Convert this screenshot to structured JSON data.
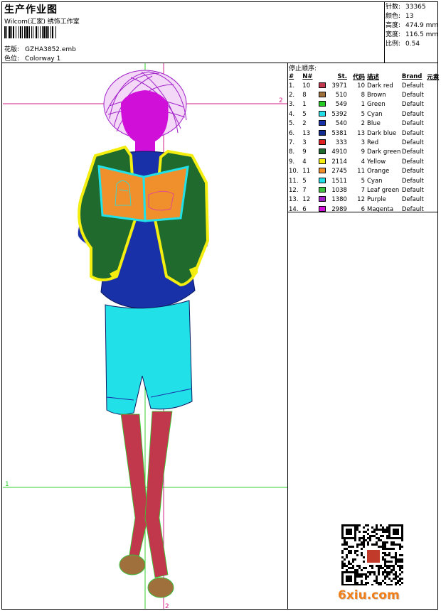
{
  "header": {
    "title": "生产作业图",
    "company": "Wilcom(汇家) 绣饰工作室",
    "design_label": "花版:",
    "design_value": "GZHA3852.emb",
    "colorway_label": "色位:",
    "colorway_value": "Colorway 1"
  },
  "stats": [
    {
      "label": "针数:",
      "value": "33365"
    },
    {
      "label": "颜色:",
      "value": "13"
    },
    {
      "label": "高度:",
      "value": "474.9 mm"
    },
    {
      "label": "宽度:",
      "value": "116.5 mm"
    },
    {
      "label": "比例:",
      "value": "0.54"
    }
  ],
  "stop_sequence": {
    "title": "停止顺序:",
    "headers": [
      "#",
      "N#",
      "St.",
      "代码",
      "描述",
      "Brand",
      "元素"
    ],
    "rows": [
      {
        "idx": "1.",
        "n": "10",
        "color": "#c1384c",
        "st": "3971",
        "code": "10",
        "desc": "Dark red",
        "brand": "Default"
      },
      {
        "idx": "2.",
        "n": "8",
        "color": "#a0703c",
        "st": "510",
        "code": "8",
        "desc": "Brown",
        "brand": "Default"
      },
      {
        "idx": "3.",
        "n": "1",
        "color": "#22cc22",
        "st": "549",
        "code": "1",
        "desc": "Green",
        "brand": "Default"
      },
      {
        "idx": "4.",
        "n": "5",
        "color": "#22e0e8",
        "st": "5392",
        "code": "5",
        "desc": "Cyan",
        "brand": "Default"
      },
      {
        "idx": "5.",
        "n": "2",
        "color": "#1830a8",
        "st": "540",
        "code": "2",
        "desc": "Blue",
        "brand": "Default"
      },
      {
        "idx": "6.",
        "n": "13",
        "color": "#102a90",
        "st": "5381",
        "code": "13",
        "desc": "Dark blue",
        "brand": "Default"
      },
      {
        "idx": "7.",
        "n": "3",
        "color": "#e02020",
        "st": "333",
        "code": "3",
        "desc": "Red",
        "brand": "Default"
      },
      {
        "idx": "8.",
        "n": "9",
        "color": "#1f6a2c",
        "st": "4910",
        "code": "9",
        "desc": "Dark green",
        "brand": "Default"
      },
      {
        "idx": "9.",
        "n": "4",
        "color": "#f4ee10",
        "st": "2114",
        "code": "4",
        "desc": "Yellow",
        "brand": "Default"
      },
      {
        "idx": "10.",
        "n": "11",
        "color": "#f0902c",
        "st": "2745",
        "code": "11",
        "desc": "Orange",
        "brand": "Default"
      },
      {
        "idx": "11.",
        "n": "5",
        "color": "#22e0e8",
        "st": "1511",
        "code": "5",
        "desc": "Cyan",
        "brand": "Default"
      },
      {
        "idx": "12.",
        "n": "7",
        "color": "#3ec03e",
        "st": "1038",
        "code": "7",
        "desc": "Leaf green",
        "brand": "Default"
      },
      {
        "idx": "13.",
        "n": "12",
        "color": "#a020c8",
        "st": "1380",
        "code": "12",
        "desc": "Purple",
        "brand": "Default"
      },
      {
        "idx": "14.",
        "n": "6",
        "color": "#d010d8",
        "st": "2989",
        "code": "6",
        "desc": "Magenta",
        "brand": "Default"
      }
    ]
  },
  "design_view": {
    "markers": {
      "top_right": "2",
      "left": "1",
      "bottom": "2"
    }
  },
  "watermark": {
    "text": "6xiu.com",
    "color": "#f07f1a"
  }
}
